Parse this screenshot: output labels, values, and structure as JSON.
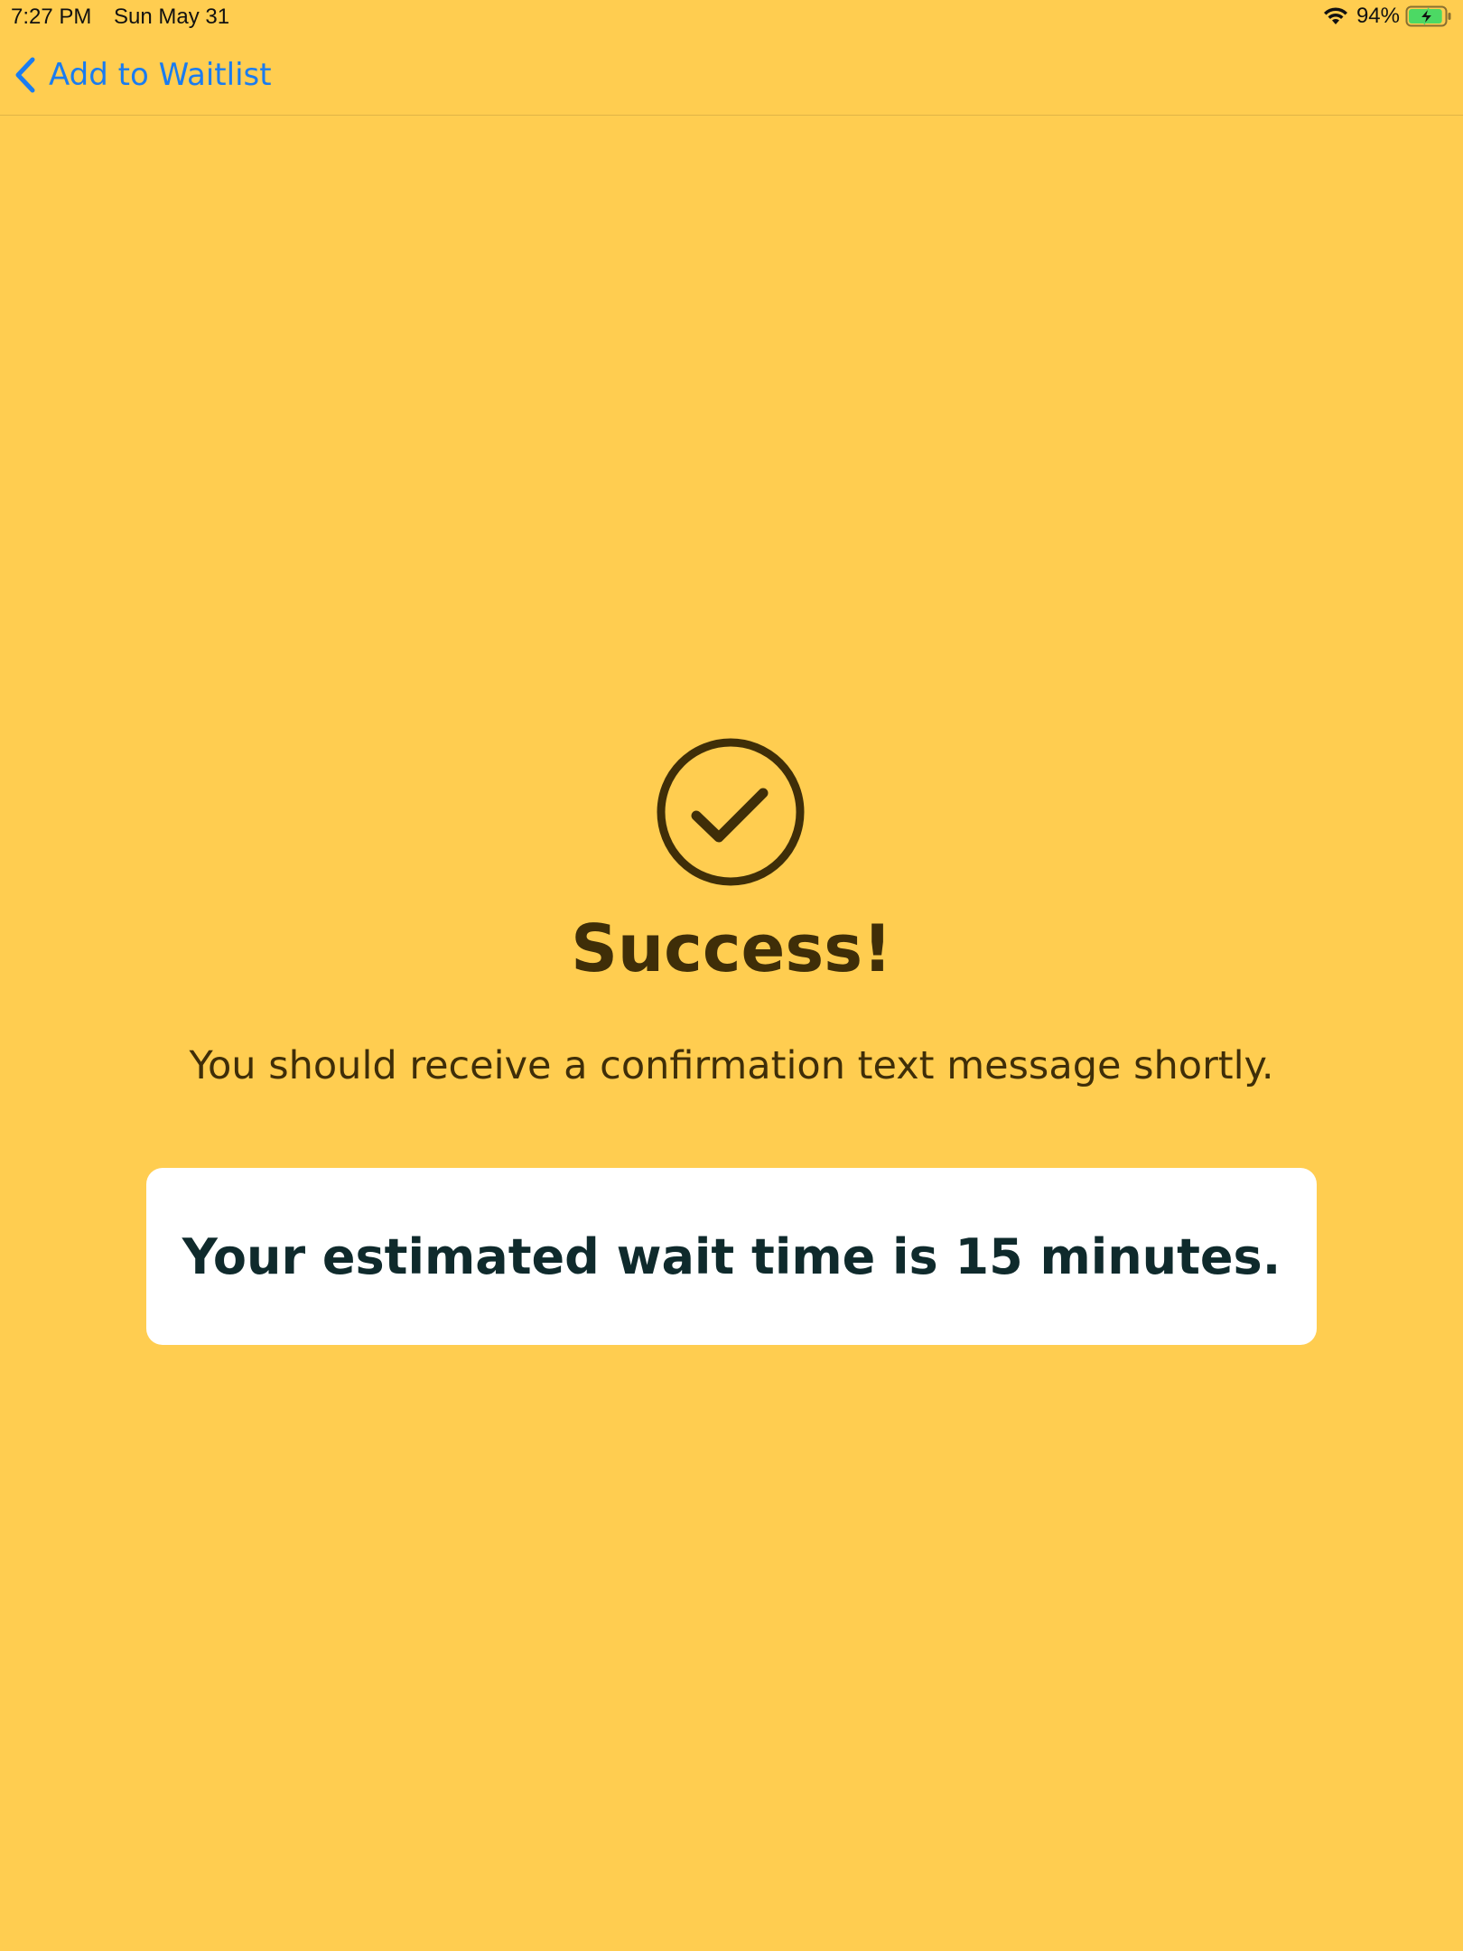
{
  "status_bar": {
    "time": "7:27 PM",
    "date": "Sun May 31",
    "battery_percent": "94%",
    "battery_level": 0.94,
    "wifi_icon": "wifi-icon",
    "battery_icon": "battery-charging-icon"
  },
  "nav": {
    "back_label": "Add to Waitlist",
    "back_icon": "chevron-left-icon"
  },
  "content": {
    "icon": "checkmark-circle-icon",
    "title": "Success!",
    "message": "You should receive a confirmation text message shortly.",
    "wait_time_text": "Your estimated wait time is 15 minutes."
  },
  "colors": {
    "background": "#FFCD50",
    "accent_link": "#1A7CF0",
    "text_dark_brown": "#3F2E08",
    "card_background": "#FFFFFF",
    "card_text": "#0F2A2C",
    "battery_green": "#4CD964"
  }
}
